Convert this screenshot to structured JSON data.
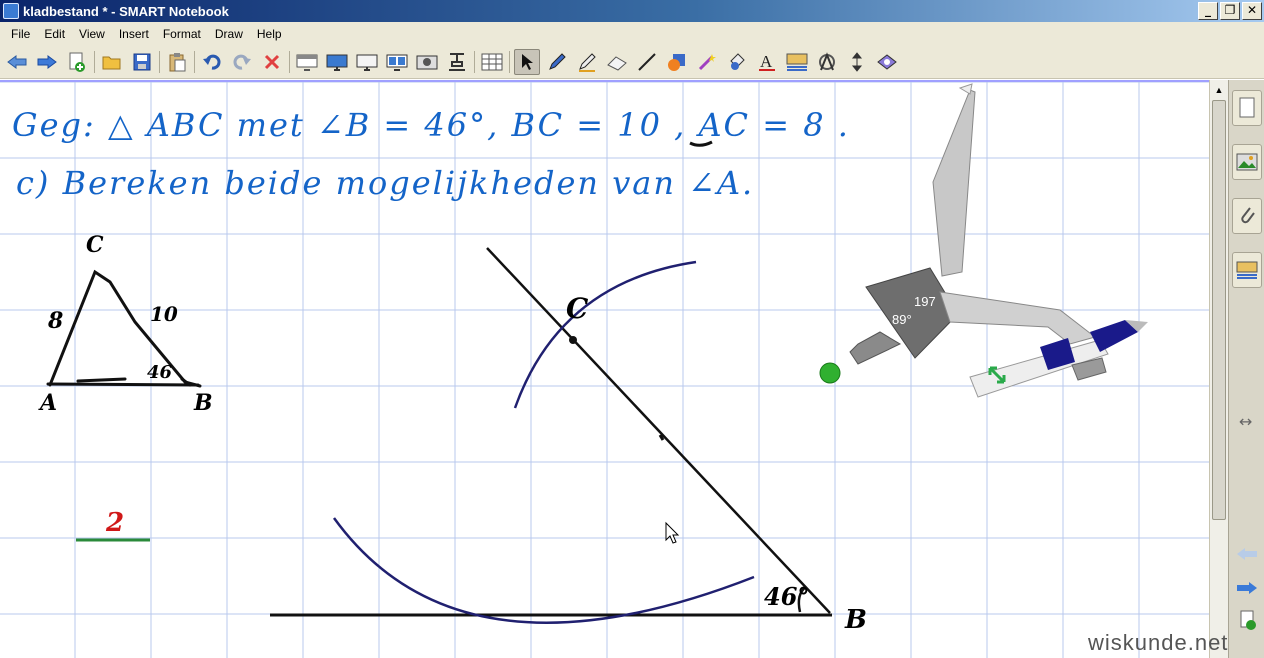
{
  "window": {
    "title": "kladbestand * - SMART Notebook",
    "buttons": [
      "_",
      "❐",
      "✕"
    ]
  },
  "menu": [
    "File",
    "Edit",
    "View",
    "Insert",
    "Format",
    "Draw",
    "Help"
  ],
  "toolbar_icons": [
    "back-arrow-icon",
    "forward-arrow-icon",
    "add-page-icon",
    "open-folder-icon",
    "save-icon",
    "paste-icon",
    "undo-icon",
    "redo-icon",
    "delete-icon",
    "screen-shade-icon",
    "full-screen-icon",
    "transparent-background-icon",
    "dual-page-icon",
    "capture-icon",
    "document-camera-icon",
    "table-icon",
    "select-arrow-icon",
    "pen-icon",
    "creative-pen-icon",
    "eraser-icon",
    "line-icon",
    "shape-icon",
    "magic-pen-icon",
    "fill-icon",
    "text-icon",
    "properties-icon",
    "measurement-tools-icon",
    "move-toolbar-icon",
    "addons-icon"
  ],
  "sidepanel_icons": [
    "page-sorter-icon",
    "gallery-icon",
    "attachments-icon",
    "properties-icon",
    "resize-arrows-icon",
    "previous-page-icon",
    "next-page-icon",
    "add-page-icon"
  ],
  "handwriting": {
    "line1": "Geg: △ ABC met ∠B = 46°, BC = 10 , AC = 8 .",
    "line2": "c) Bereken beide mogelijkheden van ∠A.",
    "sketch_labels": {
      "C": "C",
      "A": "A",
      "B": "B",
      "side_AC": "8",
      "side_BC": "10",
      "angle_B": "46"
    },
    "construction_labels": {
      "C": "C",
      "B": "B",
      "angle": "46°"
    },
    "red_note": "2"
  },
  "compass": {
    "radius_readout": "197",
    "angle_readout": "89°"
  },
  "watermark": "wiskunde.net",
  "colors": {
    "handwriting_blue": "#1464c8",
    "arc_navy": "#202070",
    "grid": "#b8c8ee",
    "green_dot": "#30b030"
  }
}
